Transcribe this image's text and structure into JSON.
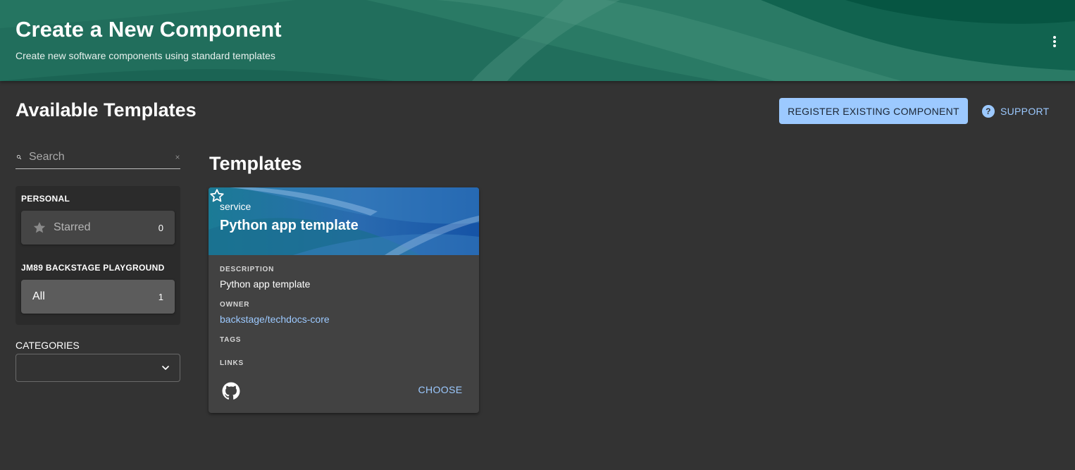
{
  "header": {
    "title": "Create a New Component",
    "subtitle": "Create new software components using standard templates",
    "menu_icon": "more-vertical-icon",
    "colors": {
      "base": "#1f6b5a",
      "dark": "#0a5a47",
      "light": "#3a8a74"
    }
  },
  "content": {
    "title": "Available Templates",
    "register_label": "REGISTER EXISTING COMPONENT",
    "support_label": "SUPPORT",
    "support_icon": "help-circle-icon",
    "accent": "#9cc9ff"
  },
  "search": {
    "placeholder": "Search",
    "value": "",
    "icon": "search-icon",
    "clear_icon": "close-icon"
  },
  "filters": {
    "personal_label": "PERSONAL",
    "starred": {
      "label": "Starred",
      "count": "0",
      "icon": "star-icon"
    },
    "org_label": "JM89 BACKSTAGE PLAYGROUND",
    "all": {
      "label": "All",
      "count": "1"
    }
  },
  "categories": {
    "label": "CATEGORIES",
    "selected": "",
    "icon": "chevron-down-icon"
  },
  "templates": {
    "heading": "Templates",
    "cards": [
      {
        "type": "service",
        "title": "Python app template",
        "description_label": "DESCRIPTION",
        "description": "Python app template",
        "owner_label": "OWNER",
        "owner": "backstage/techdocs-core",
        "tags_label": "TAGS",
        "links_label": "LINKS",
        "link_icon": "github-icon",
        "choose_label": "CHOOSE",
        "star_icon": "star-outline-icon",
        "header_colors": {
          "start": "#1b7b95",
          "end": "#1553a6"
        }
      }
    ]
  }
}
